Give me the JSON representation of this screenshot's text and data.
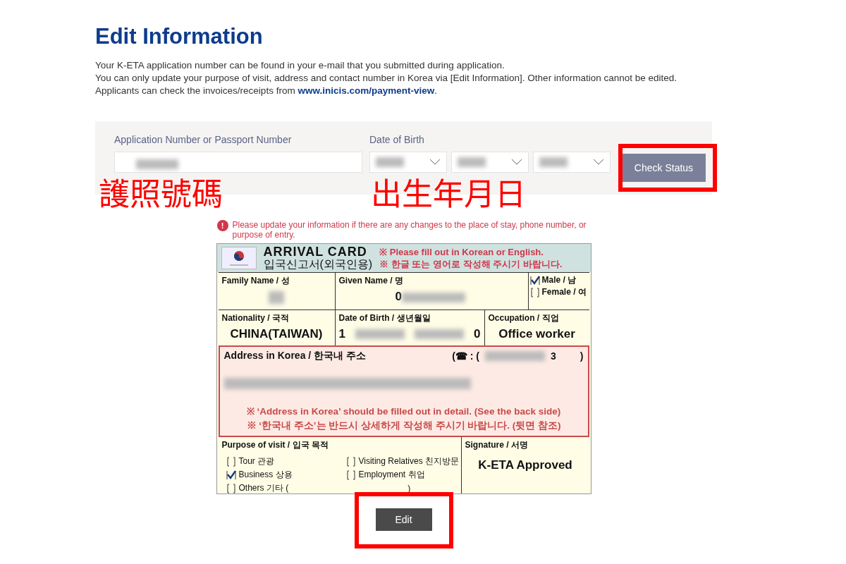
{
  "title": "Edit Information",
  "intro": [
    "Your K-ETA application number can be found in your e-mail that you submitted during application.",
    "You can only update your purpose of visit, address and contact number in Korea via [Edit Information]. Other information cannot be edited."
  ],
  "receipt": {
    "text": "Applicants can check the invoices/receipts from ",
    "link": "www.inicis.com/payment-view",
    "end": "."
  },
  "search": {
    "number_label": "Application Number or Passport Number",
    "birth_label": "Date of Birth",
    "button": "Check Status"
  },
  "annotations": {
    "number_note": "護照號碼",
    "birth_note": "出生年月日"
  },
  "notice": {
    "icon": "!",
    "text": "Please update your information if there are any changes to the place of stay, phone number, or purpose of entry."
  },
  "card": {
    "title": "ARRIVAL  CARD",
    "subtitle": "입국신고서(외국인용)",
    "notes": [
      "※ Please fill out in Korean or English.",
      "※ 한글 또는 영어로 작성해 주시기 바랍니다."
    ],
    "family_label": "Family Name / 성",
    "given_label": "Given Name / 명",
    "given_value": "0",
    "sex_options": [
      {
        "label": "Male / 남",
        "checked": true
      },
      {
        "label": "Female / 여",
        "checked": false
      }
    ],
    "nationality_label": "Nationality / 국적",
    "nationality": "CHINA(TAIWAN)",
    "birth_label": "Date of Birth / 생년월일",
    "birth_first": "1",
    "birth_last": "0",
    "occupation_label": "Occupation / 직업",
    "occupation": "Office worker",
    "address_label": "Address in Korea / 한국내 주소",
    "phone_prefix": "(☎ : (",
    "phone_end": "3",
    "phone_close": ")",
    "address_notes": [
      "※ ‘Address in Korea’ should be filled out in detail. (See the back side)",
      "※ ‘한국내 주소’는 반드시 상세하게 작성해 주시기 바랍니다. (뒷면 참조)"
    ],
    "purpose_label": "Purpose of visit / 입국 목적",
    "purposes": [
      {
        "label": "Tour 관광",
        "checked": false
      },
      {
        "label": "Visiting Relatives 친지방문",
        "checked": false
      },
      {
        "label": "Business 상용",
        "checked": true
      },
      {
        "label": "Employment 취업",
        "checked": false
      },
      {
        "label": "Others 기타 (",
        "checked": false,
        "suffix": ")"
      }
    ],
    "signature_label": "Signature / 서명",
    "signature": "K-ETA Approved"
  },
  "edit_button": "Edit"
}
